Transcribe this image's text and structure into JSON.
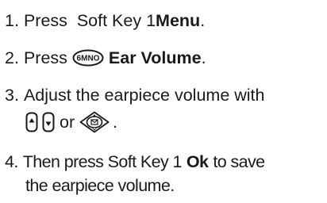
{
  "steps": [
    {
      "number": "1.",
      "pre": "Press  Soft Key 1",
      "bold": "Menu",
      "post": "."
    },
    {
      "number": "2.",
      "pre": "Press",
      "key": "6MNO",
      "key_icon": "key-6-mno-icon",
      "bold": "Ear Volume",
      "post": "."
    },
    {
      "number": "3.",
      "line1": "Adjust the earpiece volume with",
      "icons": [
        "volume-up-side-key-icon",
        "volume-down-side-key-icon",
        "navigation-key-icon"
      ],
      "or": "or",
      "post": "."
    },
    {
      "number": "4.",
      "pre": "Then press Soft Key 1",
      "bold": "Ok",
      "post_line1": "to save",
      "line2": "the earpiece volume."
    }
  ]
}
